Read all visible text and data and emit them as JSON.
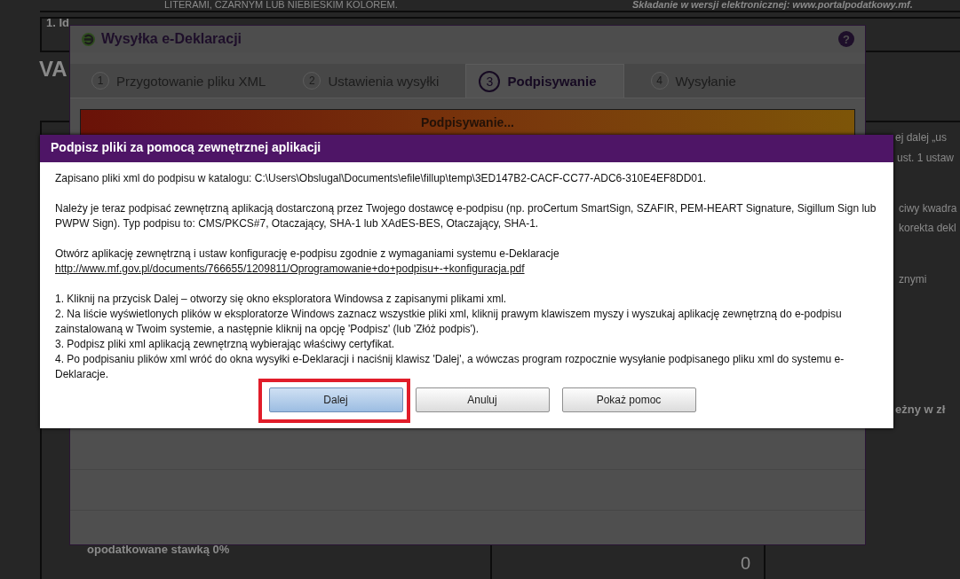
{
  "background_document": {
    "texts": [
      {
        "kind": "note",
        "text": "LITERAMI, CZARNYM LUB NIEBIESKIM KOLOREM."
      },
      {
        "kind": "note-italic",
        "text": "Składanie w wersji elektronicznej: www.portalpodatkowy.mf."
      },
      {
        "kind": "label",
        "text": "1. Id"
      },
      {
        "kind": "heading",
        "text": "VA"
      },
      {
        "kind": "text",
        "text": "ej dalej „us"
      },
      {
        "kind": "text",
        "text": "ust. 1 ustaw"
      },
      {
        "kind": "text",
        "text": "ciwy kwadra"
      },
      {
        "kind": "text",
        "text": "korekta dekl"
      },
      {
        "kind": "text",
        "text": "znymi"
      },
      {
        "kind": "label",
        "text": "eżny w zł"
      },
      {
        "kind": "label",
        "text": "opodatkowane stawką 0%"
      },
      {
        "kind": "amount",
        "text": "0"
      }
    ]
  },
  "window": {
    "title": "Wysyłka e-Deklaracji",
    "help": "?",
    "tabs": [
      {
        "number": "1",
        "label": "Przygotowanie pliku XML",
        "selected": false
      },
      {
        "number": "2",
        "label": "Ustawienia wysyłki",
        "selected": false
      },
      {
        "number": "3",
        "label": "Podpisywanie",
        "selected": true
      },
      {
        "number": "4",
        "label": "Wysyłanie",
        "selected": false
      }
    ],
    "progress": {
      "label": "Podpisywanie...",
      "level": 1
    }
  },
  "dialog": {
    "title": "Podpisz pliki za pomocą zewnętrznej aplikacji",
    "paragraphs": [
      "Zapisano pliki xml do podpisu w katalogu: C:\\Users\\Obslugal\\Documents\\efile\\fillup\\temp\\3ED147B2-CACF-CC77-ADC6-310E4EF8DD01.",
      "Należy je teraz podpisać zewnętrzną aplikacją dostarczoną przez Twojego dostawcę e-podpisu (np. proCertum SmartSign, SZAFIR, PEM-HEART Signature, Sigillum Sign lub PWPW Sign). Typ podpisu to: CMS/PKCS#7, Otaczający, SHA-1 lub XAdES-BES, Otaczający, SHA-1.",
      "Otwórz aplikację zewnętrzną i ustaw konfigurację e-podpisu zgodnie z wymaganiami systemu e-Deklaracje"
    ],
    "link": "http://www.mf.gov.pl/documents/766655/1209811/Oprogramowanie+do+podpisu+-+konfiguracja.pdf",
    "steps": [
      "1. Kliknij na przycisk Dalej – otworzy się okno eksploratora Windowsa z zapisanymi plikami xml.",
      "2. Na liście wyświetlonych plików w eksploratorze Windows zaznacz wszystkie pliki xml, kliknij prawym klawiszem myszy i wyszukaj aplikację zewnętrzną do e-podpisu zainstalowaną w Twoim systemie, a następnie kliknij na opcję 'Podpisz' (lub 'Złóż podpis').",
      "3. Podpisz pliki xml aplikacją zewnętrzną wybierając właściwy certyfikat.",
      "4. Po podpisaniu plików xml wróć do okna wysyłki e-Deklaracji i naciśnij klawisz 'Dalej', a wówczas program rozpocznie wysyłanie podpisanego pliku xml do systemu e-Deklaracje."
    ],
    "buttons": [
      {
        "label": "Dalej",
        "default": true,
        "highlighted": true
      },
      {
        "label": "Anuluj",
        "default": false,
        "highlighted": false
      },
      {
        "label": "Pokaż pomoc",
        "default": false,
        "highlighted": false
      }
    ]
  }
}
